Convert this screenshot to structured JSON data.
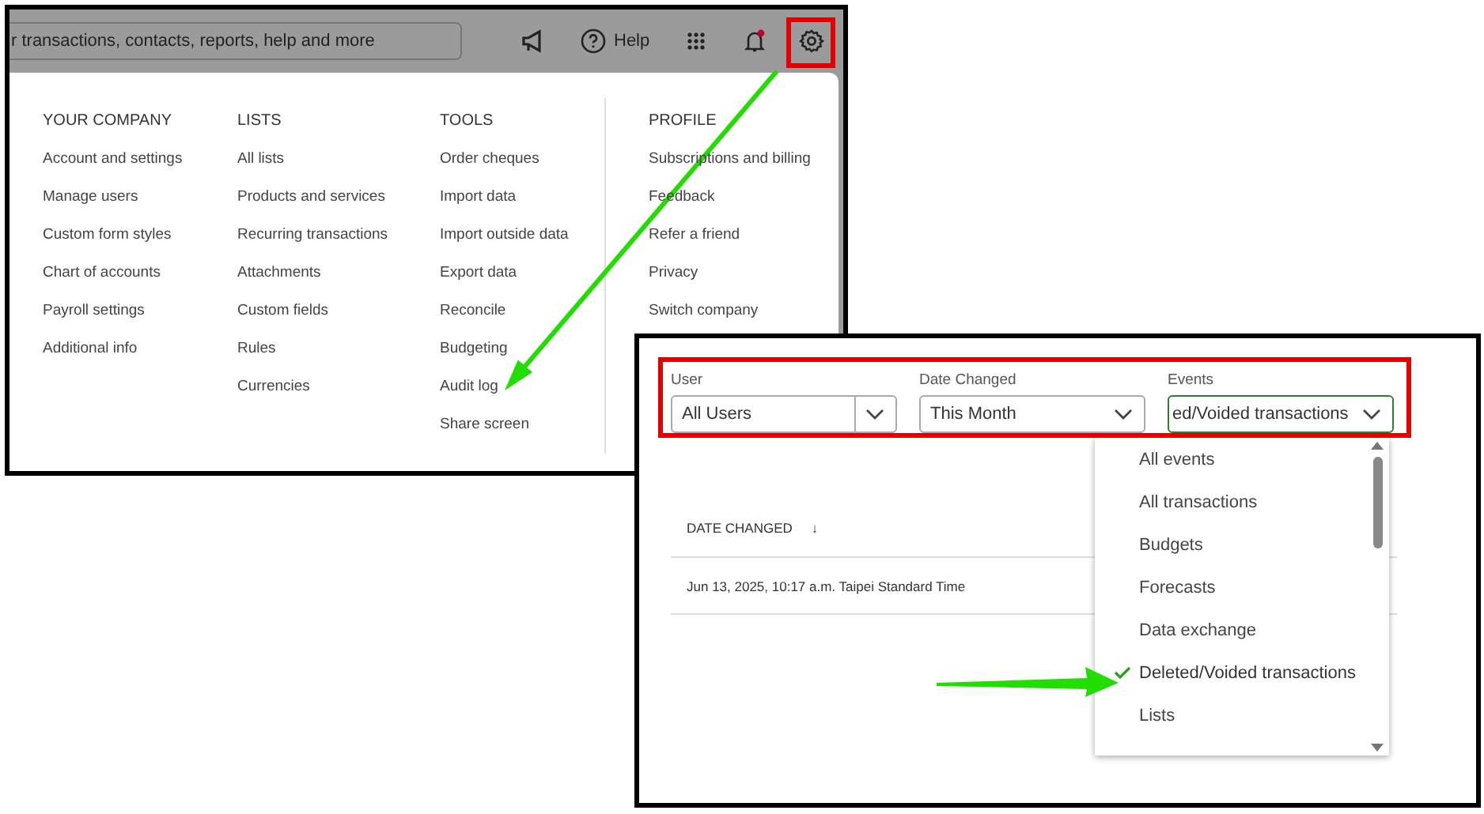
{
  "top_bar": {
    "search": {
      "value": "r transactions, contacts, reports, help and more"
    },
    "help_label": "Help",
    "notification_dot": true
  },
  "settings_menu": {
    "columns": [
      {
        "heading": "YOUR COMPANY",
        "items": [
          "Account and settings",
          "Manage users",
          "Custom form styles",
          "Chart of accounts",
          "Payroll settings",
          "Additional info"
        ]
      },
      {
        "heading": "LISTS",
        "items": [
          "All lists",
          "Products and services",
          "Recurring transactions",
          "Attachments",
          "Custom fields",
          "Rules",
          "Currencies"
        ]
      },
      {
        "heading": "TOOLS",
        "items": [
          "Order cheques",
          "Import data",
          "Import outside data",
          "Export data",
          "Reconcile",
          "Budgeting",
          "Audit log",
          "Share screen"
        ]
      },
      {
        "heading": "PROFILE",
        "items": [
          "Subscriptions and billing",
          "Feedback",
          "Refer a friend",
          "Privacy",
          "Switch company"
        ]
      }
    ]
  },
  "audit_filters": [
    {
      "label": "User",
      "value": "All Users",
      "kind": "split"
    },
    {
      "label": "Date Changed",
      "value": "This Month",
      "kind": "plain"
    },
    {
      "label": "Events",
      "value": "ed/Voided transactions",
      "kind": "focused"
    }
  ],
  "events_dropdown": {
    "options": [
      {
        "label": "All events",
        "checked": false
      },
      {
        "label": "All transactions",
        "checked": false
      },
      {
        "label": "Budgets",
        "checked": false
      },
      {
        "label": "Forecasts",
        "checked": false
      },
      {
        "label": "Data exchange",
        "checked": false
      },
      {
        "label": "Deleted/Voided transactions",
        "checked": true
      },
      {
        "label": "Lists",
        "checked": false
      }
    ]
  },
  "table": {
    "columns": [
      {
        "label": "DATE CHANGED",
        "sort_mark": "↓"
      }
    ],
    "rows": [
      {
        "date_changed": "Jun 13, 2025, 10:17 a.m. Taipei Standard Time"
      }
    ]
  }
}
